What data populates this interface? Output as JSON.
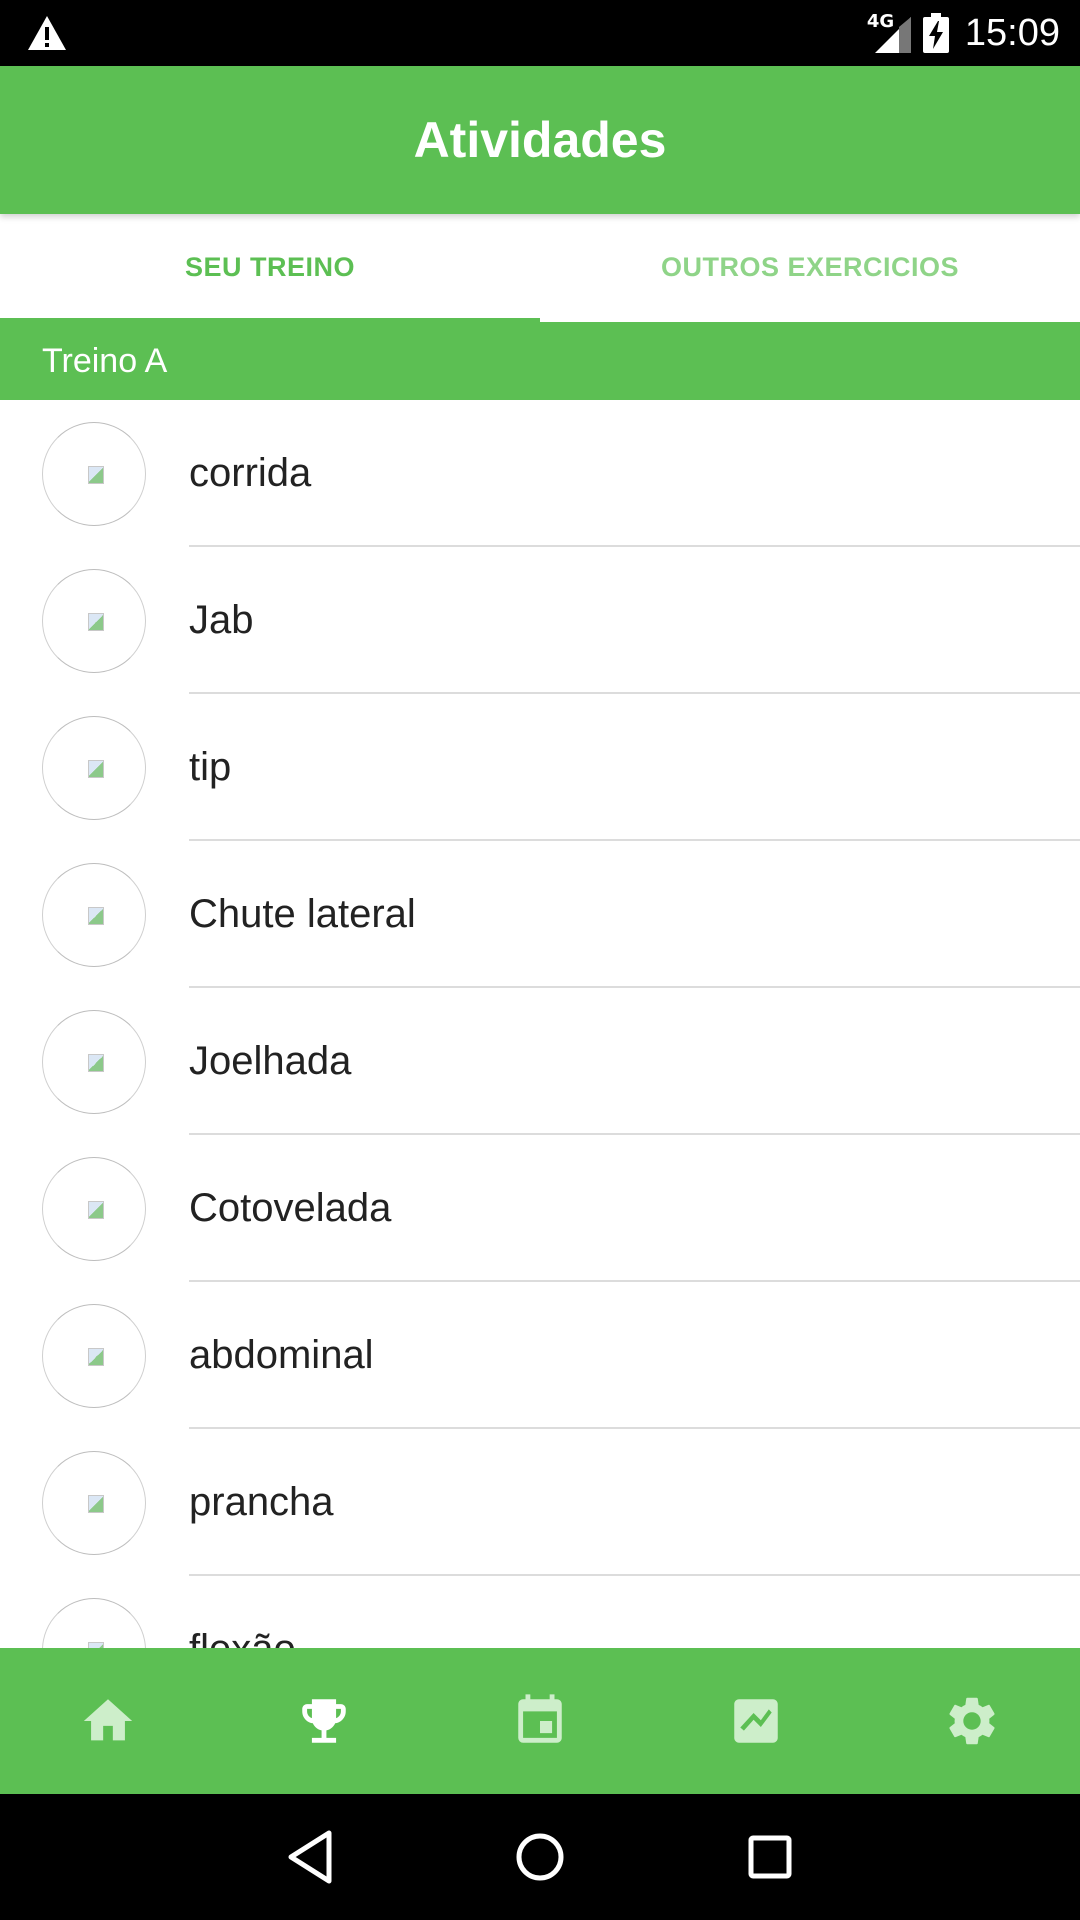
{
  "status_bar": {
    "network": "4G",
    "time": "15:09",
    "icons": [
      "warning-icon",
      "signal-icon",
      "battery-charging-icon"
    ]
  },
  "app_bar": {
    "title": "Atividades"
  },
  "tabs": [
    {
      "label": "SEU TREINO",
      "active": true
    },
    {
      "label": "OUTROS EXERCICIOS",
      "active": false
    }
  ],
  "section": {
    "title": "Treino A"
  },
  "activities": [
    {
      "name": "corrida"
    },
    {
      "name": "Jab"
    },
    {
      "name": "tip"
    },
    {
      "name": "Chute lateral"
    },
    {
      "name": "Joelhada"
    },
    {
      "name": "Cotovelada"
    },
    {
      "name": "abdominal"
    },
    {
      "name": "prancha"
    },
    {
      "name": "flexão"
    }
  ],
  "bottom_nav": {
    "items": [
      "home-icon",
      "trophy-icon",
      "calendar-icon",
      "chart-icon",
      "settings-icon"
    ]
  },
  "system_nav": {
    "items": [
      "back-icon",
      "home-circle-icon",
      "recents-icon"
    ]
  },
  "colors": {
    "primary": "#5cbf53",
    "primary_light": "#8fd488",
    "nav_icon": "#cdeeca",
    "text": "#222222",
    "divider": "#dcdcdc"
  }
}
